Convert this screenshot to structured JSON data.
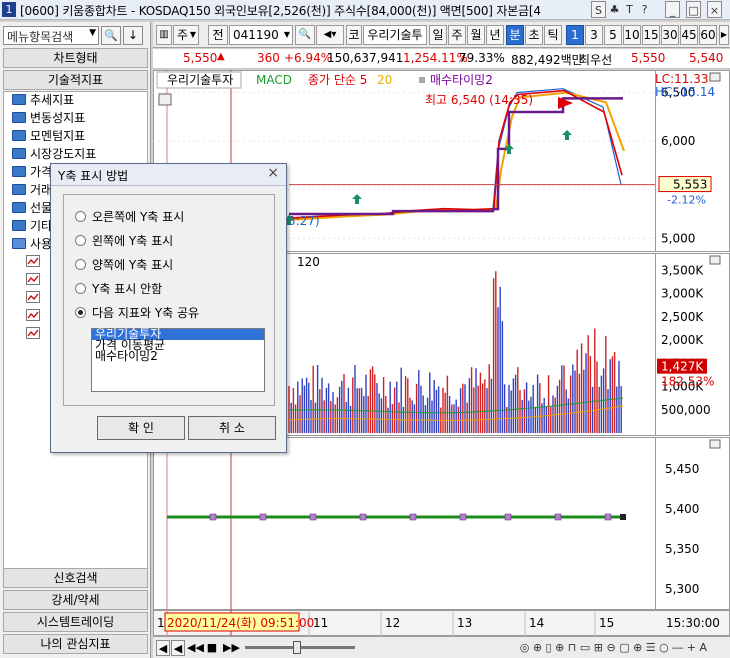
{
  "titlebar": {
    "window_number": "1",
    "title": "[0600] 키움종합차트 - KOSDAQ150 외국인보유[2,526(천)] 주식수[84,000(천)] 액면[500] 자본금[4",
    "buttons": [
      "S",
      "♣",
      "T",
      "?",
      "_",
      "□",
      "×"
    ]
  },
  "left": {
    "search_placeholder": "메뉴항목검색",
    "search_btn": "🔍",
    "down_btn": "↓",
    "header_chart_type": "차트형태",
    "header_tech": "기술적지표",
    "tree": [
      "추세지표",
      "변동성지표",
      "모멘텀지표",
      "시장강도지표",
      "가격",
      "거래",
      "선물",
      "기타",
      "사용"
    ],
    "bottom_buttons": [
      "신호검색",
      "강세/약세",
      "시스템트레이딩",
      "나의 관심지표"
    ]
  },
  "toolbar": {
    "mode": "주",
    "mode2": "전",
    "code": "041190",
    "name_prefix": "코",
    "name": "우리기술투",
    "periods": [
      "일",
      "주",
      "월",
      "년",
      "분",
      "초",
      "틱"
    ],
    "selected_period": "분",
    "intervals": [
      "1",
      "3",
      "5",
      "10",
      "15",
      "30",
      "45",
      "60"
    ],
    "selected_interval": "1"
  },
  "info": {
    "price": "5,550",
    "change": "360",
    "pct": "+6.94%",
    "volume": "150,637,941",
    "vol_pct": "1,254.11%",
    "ratio": "79.33%",
    "amount": "882,492백만",
    "label_pref": "최우선",
    "bid": "5,550",
    "ask": "5,540"
  },
  "legend": {
    "stock": "우리기술투자",
    "macd": "MACD",
    "ma": "종가 단순 5",
    "ma2": "20",
    "signal": "매수타이밍2",
    "lc": "LC:11.33",
    "hc": "HC:-15.14"
  },
  "annotations": {
    "high": "최고 6,540 (14:35)",
    "low_time": "3:27)",
    "vol_label": "120",
    "time_cursor": "2020/11/24(화) 09:51:00",
    "end_time": "15:30:00"
  },
  "price_axis": {
    "ticks": [
      "6,500",
      "6,000",
      "5,553",
      "-2.12%",
      "5,000"
    ],
    "current": "5,553",
    "current_pct": "-2.12%"
  },
  "volume_axis": {
    "ticks": [
      "3,500K",
      "3,000K",
      "2,500K",
      "2,000K",
      "1,500K",
      "1,000K",
      "500,000"
    ],
    "current": "1,427K",
    "current_pct": "182.53%"
  },
  "signal_axis": {
    "ticks": [
      "5,450",
      "5,400",
      "5,350",
      "5,300"
    ]
  },
  "x_axis": {
    "labels": [
      "11",
      "12",
      "13",
      "14",
      "15"
    ],
    "row_num": "1"
  },
  "dialog": {
    "title": "Y축 표시 방법",
    "close": "×",
    "options": [
      "오른쪽에 Y축 표시",
      "왼쪽에 Y축 표시",
      "양쪽에 Y축 표시",
      "Y축 표시 안함",
      "다음 지표와 Y축 공유"
    ],
    "selected_index": 4,
    "list": [
      "우리기술투자",
      "가격 이동평균",
      "매수타이밍2"
    ],
    "ok": "확 인",
    "cancel": "취 소"
  },
  "chart_data": [
    {
      "type": "line",
      "title": "",
      "series": [
        {
          "name": "우리기술투자",
          "x": [
            "09:51",
            "10:30",
            "11:00",
            "11:30",
            "12:00",
            "12:30",
            "13:00",
            "13:20",
            "13:40",
            "14:00",
            "14:35",
            "15:00",
            "15:20"
          ],
          "values": [
            5200,
            5230,
            5250,
            5280,
            5300,
            5290,
            5300,
            5900,
            6350,
            6500,
            6540,
            6350,
            5553
          ]
        }
      ],
      "ylim": [
        4900,
        6650
      ]
    },
    {
      "type": "bar",
      "title": "",
      "ylim": [
        0,
        3700000
      ]
    },
    {
      "type": "line",
      "series": [
        {
          "name": "매수타이밍2",
          "values": [
            5390,
            5390,
            5390,
            5390,
            5390,
            5390,
            5390,
            5390,
            5390
          ]
        }
      ],
      "ylim": [
        5280,
        5480
      ]
    }
  ]
}
